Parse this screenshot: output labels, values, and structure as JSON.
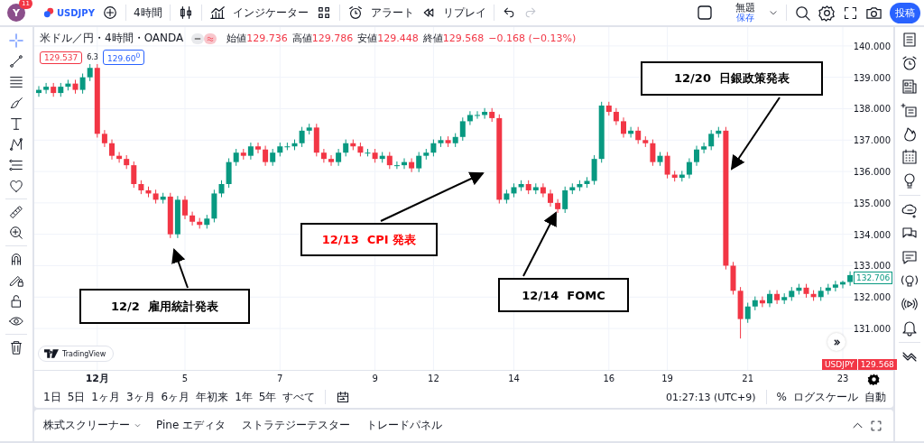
{
  "top_bar": {
    "avatar": {
      "letter": "Y",
      "badge": "11"
    },
    "symbol": "USDJPY",
    "interval": "4時間",
    "indicators": "インジケーター",
    "alerts": "アラート",
    "replay": "リプレイ",
    "history": {
      "undo_disabled": false,
      "redo_disabled": true
    },
    "layout": {
      "title": "無題",
      "status": "保存"
    },
    "publish": "投稿"
  },
  "left_toolbar": {
    "tools": [
      {
        "selected": true
      },
      {
        "selected": false
      },
      {
        "selected": false
      },
      {
        "selected": false
      },
      {
        "selected": false
      },
      {
        "selected": false
      },
      {
        "selected": false
      },
      {
        "selected": false
      },
      {
        "selected": false
      },
      {
        "selected": false
      },
      {
        "selected": false
      },
      {
        "selected": false
      },
      {
        "selected": false
      },
      {
        "selected": false
      },
      {
        "selected": false
      }
    ]
  },
  "chart": {
    "legend": {
      "title": "米ドル／円・4時間・OANDA",
      "values": [
        {
          "label": "始値",
          "value": "129.736"
        },
        {
          "label": "高値",
          "value": "129.786"
        },
        {
          "label": "安値",
          "value": "129.448"
        },
        {
          "label": "終値",
          "value": "129.568"
        }
      ],
      "change": "−0.168 (−0.13%)",
      "bid": "129.537",
      "spread": "6.3",
      "ask": "129.60$^{0}$"
    },
    "logo": "TradingView",
    "last_price": "132.706",
    "symbol_tag": {
      "symbol": "USDJPY",
      "price": "129.568"
    },
    "callouts": [
      {
        "text": "12/2  雇用統計発表",
        "color": "#000000"
      },
      {
        "text": "12/13  CPI 発表",
        "color": "#ff0000"
      },
      {
        "text": "12/14  FOMC",
        "color": "#000000"
      },
      {
        "text": "12/20  日銀政策発表",
        "color": "#000000"
      }
    ],
    "chart_data": {
      "type": "candlestick",
      "grid": true,
      "ylim": [
        129.68,
        140.6
      ],
      "categories": [
        null,
        null,
        null,
        null,
        null,
        null,
        null,
        null,
        "12月",
        null,
        null,
        null,
        null,
        null,
        null,
        null,
        null,
        null,
        null,
        null,
        "5",
        null,
        null,
        null,
        null,
        null,
        null,
        null,
        null,
        null,
        null,
        null,
        null,
        "7",
        null,
        null,
        null,
        null,
        null,
        null,
        null,
        null,
        null,
        null,
        null,
        null,
        "9",
        null,
        null,
        null,
        null,
        null,
        null,
        null,
        "12",
        null,
        null,
        null,
        null,
        null,
        null,
        null,
        null,
        null,
        null,
        "14",
        null,
        null,
        null,
        null,
        null,
        null,
        null,
        null,
        null,
        null,
        null,
        null,
        "16",
        null,
        null,
        null,
        null,
        null,
        null,
        null,
        "19",
        null,
        null,
        null,
        null,
        null,
        null,
        null,
        null,
        null,
        null,
        "21",
        null,
        null,
        null,
        null,
        null,
        null,
        null,
        null,
        null,
        null,
        null,
        null,
        "23",
        null
      ],
      "ohlc": [
        [
          138.5,
          138.72,
          138.38,
          138.6
        ],
        [
          138.6,
          138.82,
          138.48,
          138.7
        ],
        [
          138.7,
          138.82,
          138.38,
          138.5
        ],
        [
          138.5,
          138.82,
          138.38,
          138.7
        ],
        [
          138.7,
          138.92,
          138.58,
          138.8
        ],
        [
          138.8,
          138.92,
          138.48,
          138.6
        ],
        [
          138.6,
          139.12,
          138.48,
          139.0
        ],
        [
          139.0,
          139.42,
          138.88,
          139.3
        ],
        [
          139.3,
          139.42,
          137.08,
          137.2
        ],
        [
          137.2,
          137.32,
          136.78,
          136.9
        ],
        [
          136.9,
          137.02,
          136.38,
          136.5
        ],
        [
          136.5,
          136.62,
          136.28,
          136.4
        ],
        [
          136.4,
          136.52,
          136.08,
          136.2
        ],
        [
          136.2,
          136.32,
          135.48,
          135.6
        ],
        [
          135.6,
          135.72,
          135.28,
          135.4
        ],
        [
          135.4,
          135.52,
          135.18,
          135.3
        ],
        [
          135.3,
          135.42,
          134.98,
          135.1
        ],
        [
          135.1,
          135.32,
          134.98,
          135.2
        ],
        [
          135.2,
          135.32,
          133.88,
          134.0
        ],
        [
          134.0,
          135.22,
          133.88,
          135.1
        ],
        [
          135.1,
          135.22,
          134.48,
          134.6
        ],
        [
          134.6,
          134.72,
          134.28,
          134.4
        ],
        [
          134.4,
          134.52,
          134.18,
          134.3
        ],
        [
          134.3,
          134.62,
          134.18,
          134.5
        ],
        [
          134.5,
          135.42,
          134.38,
          135.3
        ],
        [
          135.3,
          135.72,
          135.18,
          135.6
        ],
        [
          135.6,
          136.42,
          135.48,
          136.3
        ],
        [
          136.3,
          136.72,
          136.18,
          136.6
        ],
        [
          136.6,
          136.72,
          136.38,
          136.5
        ],
        [
          136.5,
          136.92,
          136.38,
          136.8
        ],
        [
          136.8,
          136.92,
          136.58,
          136.7
        ],
        [
          136.7,
          136.82,
          136.18,
          136.3
        ],
        [
          136.3,
          136.72,
          136.18,
          136.6
        ],
        [
          136.6,
          136.92,
          136.48,
          136.8
        ],
        [
          136.8,
          136.92,
          136.68,
          136.8
        ],
        [
          136.8,
          137.02,
          136.68,
          136.9
        ],
        [
          136.9,
          137.42,
          136.78,
          137.3
        ],
        [
          137.3,
          137.52,
          137.18,
          137.4
        ],
        [
          137.4,
          137.52,
          136.48,
          136.6
        ],
        [
          136.6,
          136.72,
          136.28,
          136.4
        ],
        [
          136.4,
          136.52,
          136.18,
          136.3
        ],
        [
          136.3,
          136.72,
          136.18,
          136.6
        ],
        [
          136.6,
          137.02,
          136.48,
          136.9
        ],
        [
          136.9,
          137.02,
          136.68,
          136.8
        ],
        [
          136.8,
          136.92,
          136.48,
          136.6
        ],
        [
          136.6,
          136.72,
          136.48,
          136.6
        ],
        [
          136.6,
          136.72,
          136.28,
          136.4
        ],
        [
          136.4,
          136.62,
          136.28,
          136.5
        ],
        [
          136.5,
          136.62,
          136.08,
          136.2
        ],
        [
          136.2,
          136.32,
          136.08,
          136.2
        ],
        [
          136.2,
          136.42,
          136.08,
          136.3
        ],
        [
          136.3,
          136.42,
          135.98,
          136.1
        ],
        [
          136.1,
          136.62,
          135.98,
          136.5
        ],
        [
          136.5,
          136.72,
          136.38,
          136.6
        ],
        [
          136.6,
          137.02,
          136.48,
          136.9
        ],
        [
          136.9,
          137.12,
          136.78,
          137.0
        ],
        [
          137.0,
          137.12,
          136.78,
          136.9
        ],
        [
          136.9,
          137.22,
          136.78,
          137.1
        ],
        [
          137.1,
          137.72,
          136.98,
          137.6
        ],
        [
          137.6,
          137.92,
          137.48,
          137.8
        ],
        [
          137.8,
          137.92,
          137.68,
          137.8
        ],
        [
          137.8,
          138.02,
          137.68,
          137.9
        ],
        [
          137.9,
          138.02,
          137.58,
          137.7
        ],
        [
          137.7,
          137.82,
          134.98,
          135.1
        ],
        [
          135.1,
          135.42,
          134.98,
          135.3
        ],
        [
          135.3,
          135.62,
          135.18,
          135.5
        ],
        [
          135.5,
          135.72,
          135.38,
          135.6
        ],
        [
          135.6,
          135.72,
          135.28,
          135.4
        ],
        [
          135.4,
          135.62,
          135.28,
          135.5
        ],
        [
          135.5,
          135.62,
          135.18,
          135.3
        ],
        [
          135.3,
          135.42,
          134.88,
          135.0
        ],
        [
          135.0,
          135.12,
          134.68,
          134.8
        ],
        [
          134.8,
          135.52,
          134.68,
          135.4
        ],
        [
          135.4,
          135.62,
          135.28,
          135.5
        ],
        [
          135.5,
          135.72,
          135.38,
          135.6
        ],
        [
          135.6,
          135.82,
          135.48,
          135.7
        ],
        [
          135.7,
          136.52,
          135.58,
          136.4
        ],
        [
          136.4,
          138.22,
          136.28,
          138.1
        ],
        [
          138.1,
          138.22,
          137.78,
          137.9
        ],
        [
          137.9,
          138.02,
          137.48,
          137.6
        ],
        [
          137.6,
          137.72,
          137.08,
          137.2
        ],
        [
          137.2,
          137.42,
          137.08,
          137.3
        ],
        [
          137.3,
          137.42,
          136.88,
          137.0
        ],
        [
          137.0,
          137.12,
          136.78,
          136.9
        ],
        [
          136.9,
          137.02,
          136.18,
          136.3
        ],
        [
          136.3,
          136.62,
          136.18,
          136.5
        ],
        [
          136.5,
          136.62,
          135.78,
          135.9
        ],
        [
          135.9,
          136.02,
          135.68,
          135.8
        ],
        [
          135.8,
          136.02,
          135.68,
          135.9
        ],
        [
          135.9,
          136.42,
          135.78,
          136.3
        ],
        [
          136.3,
          136.82,
          136.18,
          136.7
        ],
        [
          136.7,
          136.92,
          136.58,
          136.8
        ],
        [
          136.8,
          137.32,
          136.68,
          137.2
        ],
        [
          137.2,
          137.42,
          137.08,
          137.3
        ],
        [
          137.3,
          137.42,
          132.88,
          133.0
        ],
        [
          133.0,
          133.12,
          132.08,
          132.2
        ],
        [
          132.2,
          132.32,
          130.68,
          131.3
        ],
        [
          131.3,
          131.82,
          131.18,
          131.7
        ],
        [
          131.7,
          132.02,
          131.58,
          131.9
        ],
        [
          131.9,
          132.02,
          131.68,
          131.8
        ],
        [
          131.8,
          132.22,
          131.68,
          132.1
        ],
        [
          132.1,
          132.22,
          131.78,
          131.9
        ],
        [
          131.9,
          132.12,
          131.78,
          132.0
        ],
        [
          132.0,
          132.32,
          131.88,
          132.2
        ],
        [
          132.2,
          132.42,
          132.08,
          132.3
        ],
        [
          132.3,
          132.42,
          131.98,
          132.1
        ],
        [
          132.1,
          132.22,
          131.88,
          132.0
        ],
        [
          132.0,
          132.32,
          131.88,
          132.2
        ],
        [
          132.2,
          132.42,
          132.08,
          132.3
        ],
        [
          132.3,
          132.52,
          132.18,
          132.4
        ],
        [
          132.4,
          132.52,
          132.28,
          132.48
        ],
        [
          132.48,
          132.82,
          132.36,
          132.7
        ]
      ],
      "yticks": [
        {
          "value": 140,
          "label": "140.000"
        },
        {
          "value": 139,
          "label": "139.000"
        },
        {
          "value": 138,
          "label": "138.000"
        },
        {
          "value": 137,
          "label": "137.000"
        },
        {
          "value": 136,
          "label": "136.000"
        },
        {
          "value": 135,
          "label": "135.000"
        },
        {
          "value": 134,
          "label": "134.000"
        },
        {
          "value": 133,
          "label": "133.000"
        },
        {
          "value": 132,
          "label": "132.000"
        },
        {
          "value": 131,
          "label": "131.000"
        }
      ]
    }
  },
  "range_bar": {
    "ranges": [
      "1日",
      "5日",
      "1ヶ月",
      "3ヶ月",
      "6ヶ月",
      "年初来",
      "1年",
      "5年",
      "すべて"
    ],
    "time": "01:27:13 (UTC+9)",
    "percent": "%",
    "log_scale": "ログスケール",
    "auto": "自動"
  },
  "bottom_panel": {
    "tabs": [
      {
        "label": "株式スクリーナー",
        "dropdown": true
      },
      {
        "label": "Pine エディタ",
        "dropdown": false
      },
      {
        "label": "ストラテジーテスター",
        "dropdown": false
      },
      {
        "label": "トレードパネル",
        "dropdown": false
      }
    ]
  }
}
